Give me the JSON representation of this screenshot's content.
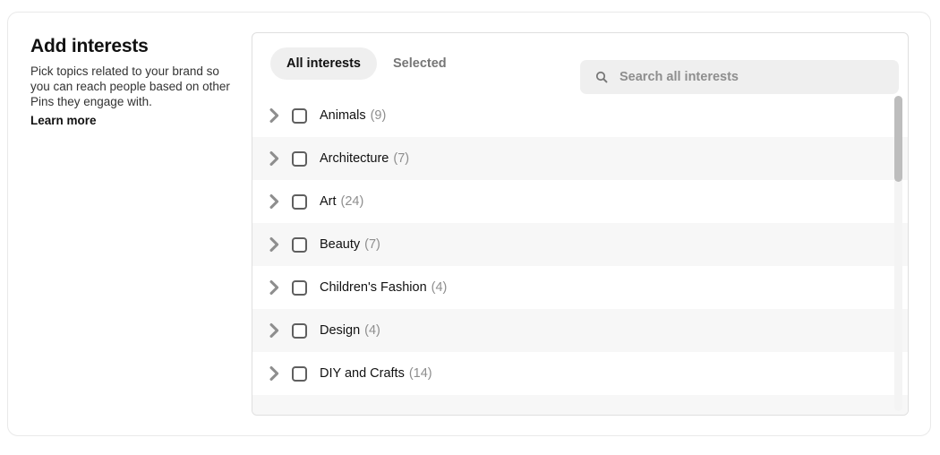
{
  "info": {
    "title": "Add interests",
    "description": "Pick topics related to your brand so you can reach people based on other Pins they engage with.",
    "learn_more_label": "Learn more"
  },
  "panel": {
    "tabs": [
      {
        "label": "All interests",
        "active": true
      },
      {
        "label": "Selected",
        "active": false
      }
    ],
    "search": {
      "placeholder": "Search all interests",
      "value": "",
      "icon": "search-icon"
    },
    "list": {
      "row_icon": "chevron-right-icon",
      "checkbox_icon": "checkbox-unchecked-icon",
      "items": [
        {
          "label": "Animals",
          "count": "(9)",
          "checked": false
        },
        {
          "label": "Architecture",
          "count": "(7)",
          "checked": false
        },
        {
          "label": "Art",
          "count": "(24)",
          "checked": false
        },
        {
          "label": "Beauty",
          "count": "(7)",
          "checked": false
        },
        {
          "label": "Children's Fashion",
          "count": "(4)",
          "checked": false
        },
        {
          "label": "Design",
          "count": "(4)",
          "checked": false
        },
        {
          "label": "DIY and Crafts",
          "count": "(14)",
          "checked": false
        }
      ]
    },
    "scrollbar": {
      "name": "vertical-scrollbar"
    }
  },
  "colors": {
    "text_primary": "#111111",
    "text_secondary": "#767676",
    "text_muted": "#8e8e8e",
    "row_alt_bg": "#f7f7f7",
    "pill_bg": "#efefef",
    "search_bg": "#efefef",
    "border": "#dfdfdf",
    "scroll_thumb": "#bdbdbd"
  }
}
